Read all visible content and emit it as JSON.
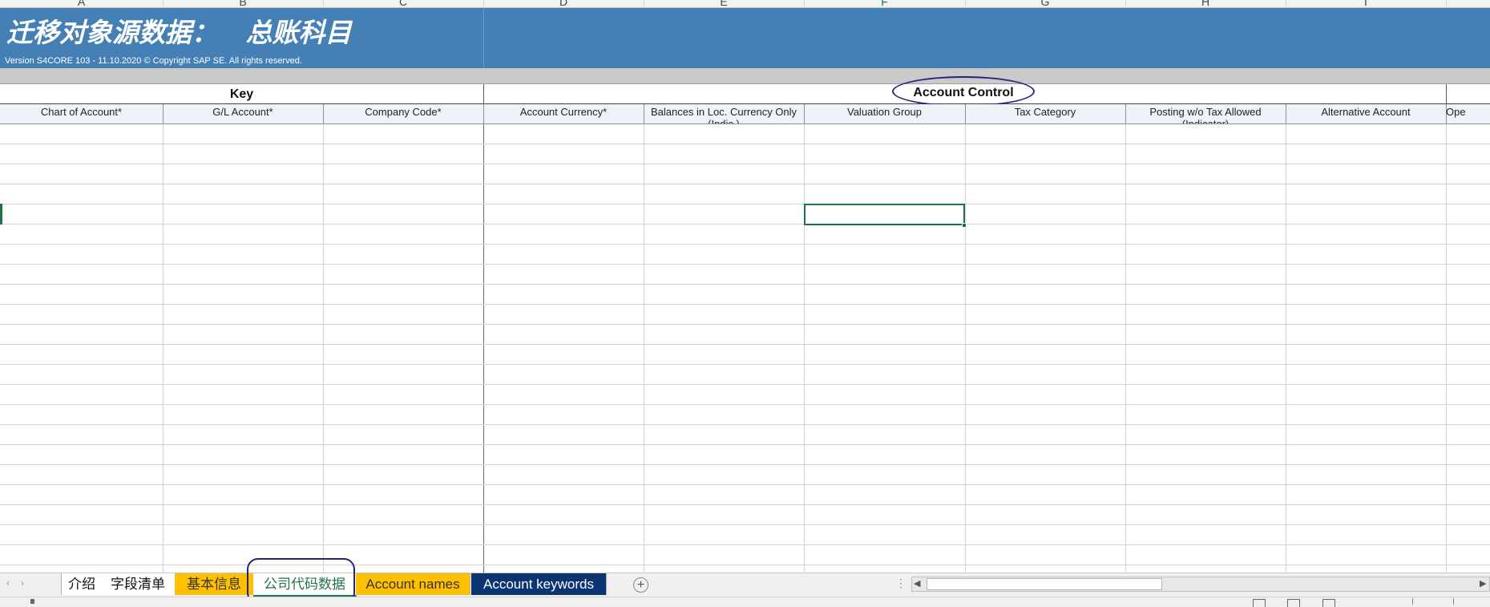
{
  "columns": [
    "A",
    "B",
    "C",
    "D",
    "E",
    "F",
    "G",
    "H",
    "I"
  ],
  "selected_column": "F",
  "header": {
    "title": "迁移对象源数据：   总账科目",
    "version": "Version S4CORE 103  - 11.10.2020 © Copyright SAP SE. All rights reserved."
  },
  "groups": {
    "key": "Key",
    "account_control": "Account Control"
  },
  "column_names": [
    "Chart of Account*",
    "G/L Account*",
    "Company Code*",
    "Account Currency*",
    "Balances in Loc. Currency Only (Indic.)",
    "Valuation Group",
    "Tax Category",
    "Posting w/o Tax Allowed (Indicator)",
    "Alternative Account",
    "Ope"
  ],
  "sheet_tabs": [
    "介绍",
    "字段清单",
    "基本信息",
    "公司代码数据",
    "Account names",
    "Account keywords"
  ],
  "active_sheet": "公司代码数据",
  "add_sheet_symbol": "+",
  "colors": {
    "title_band": "#4480b5",
    "header_fill": "#edf3f8",
    "accent_green": "#217346",
    "tab_yellow": "#ffc000",
    "tab_navy": "#0b3470",
    "annotation_ring": "#23237a"
  }
}
